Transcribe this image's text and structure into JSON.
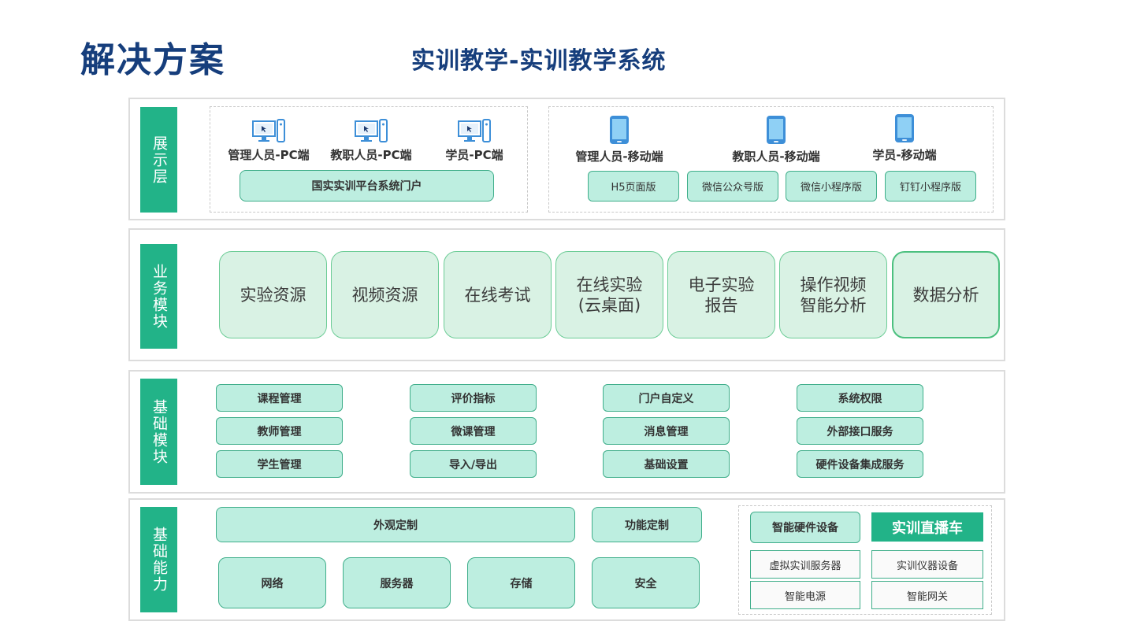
{
  "page": {
    "title": "解决方案",
    "subtitle": "实训教学-实训教学系统"
  },
  "layers": {
    "display": {
      "label": "展示层",
      "pc_clients": [
        "管理人员-PC端",
        "教职人员-PC端",
        "学员-PC端"
      ],
      "pc_portal": "国实实训平台系统门户",
      "mobile_clients": [
        "管理人员-移动端",
        "教职人员-移动端",
        "学员-移动端"
      ],
      "mobile_versions": [
        "H5页面版",
        "微信公众号版",
        "微信小程序版",
        "钉钉小程序版"
      ]
    },
    "business": {
      "label": "业务模块",
      "modules": [
        "实验资源",
        "视频资源",
        "在线考试",
        "在线实验\n(云桌面)",
        "电子实验\n报告",
        "操作视频\n智能分析",
        "数据分析"
      ]
    },
    "foundation": {
      "label": "基础模块",
      "columns": [
        [
          "课程管理",
          "教师管理",
          "学生管理"
        ],
        [
          "评价指标",
          "微课管理",
          "导入/导出"
        ],
        [
          "门户自定义",
          "消息管理",
          "基础设置"
        ],
        [
          "系统权限",
          "外部接口服务",
          "硬件设备集成服务"
        ]
      ]
    },
    "capability": {
      "label": "基础能力",
      "appearance": "外观定制",
      "function": "功能定制",
      "infra": [
        "网络",
        "服务器",
        "存储",
        "安全"
      ],
      "hardware": {
        "smart_devices": "智能硬件设备",
        "live_car": "实训直播车",
        "items": [
          "虚拟实训服务器",
          "实训仪器设备",
          "智能电源",
          "智能网关"
        ]
      }
    }
  },
  "colors": {
    "label_green": "#22b388",
    "pill_fill": "#bdeee0",
    "module_fill": "#d9f2e4",
    "title_navy": "#163e7c"
  }
}
